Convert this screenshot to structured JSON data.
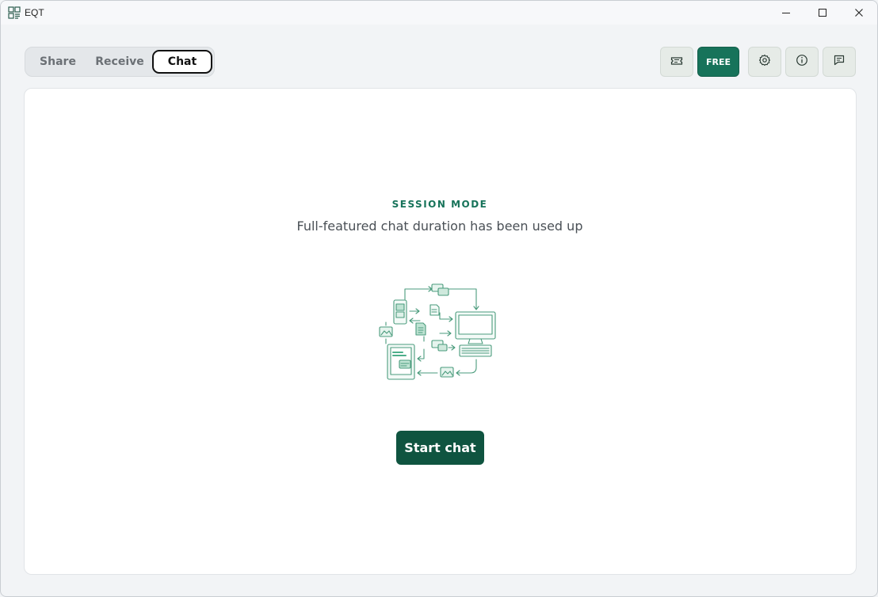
{
  "window": {
    "title": "EQT",
    "icons": {
      "app": "app-logo-icon",
      "minimize": "minimize-icon",
      "maximize": "maximize-icon",
      "close": "close-icon"
    }
  },
  "tabs": [
    {
      "label": "Share",
      "selected": false
    },
    {
      "label": "Receive",
      "selected": false
    },
    {
      "label": "Chat",
      "selected": true
    }
  ],
  "toolbar": {
    "ticket_icon": "ticket-icon",
    "free_label": "FREE",
    "settings_icon": "gear-icon",
    "info_icon": "info-icon",
    "feedback_icon": "message-icon"
  },
  "main": {
    "session_mode": "SESSION MODE",
    "message": "Full-featured chat duration has been used up",
    "illustration": "device-sync-illustration",
    "start_chat_label": "Start chat"
  },
  "colors": {
    "accent": "#17735a",
    "button_dark": "#0f5440",
    "illustration_green": "#4cae8a"
  }
}
